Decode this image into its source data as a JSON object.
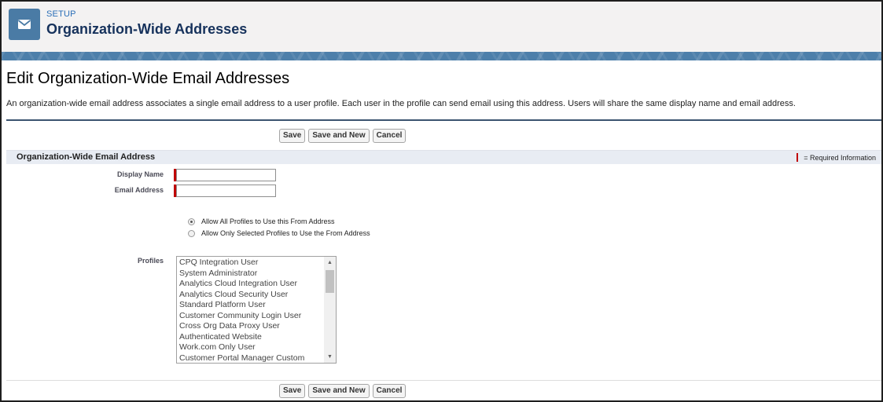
{
  "header": {
    "eyebrow": "SETUP",
    "title": "Organization-Wide Addresses",
    "icon": "envelope-icon",
    "icon_bg": "#4a7ba5"
  },
  "page": {
    "title": "Edit Organization-Wide Email Addresses",
    "description": "An organization-wide email address associates a single email address to a user profile. Each user in the profile can send email using this address. Users will share the same display name and email address."
  },
  "buttons": {
    "save": "Save",
    "save_new": "Save and New",
    "cancel": "Cancel"
  },
  "section": {
    "title": "Organization-Wide Email Address",
    "required_legend": "= Required Information",
    "required_color": "#c00000"
  },
  "form": {
    "display_name_label": "Display Name",
    "display_name_value": "",
    "email_label": "Email Address",
    "email_value": "",
    "radio_all": "Allow All Profiles to Use this From Address",
    "radio_selected": "Allow Only Selected Profiles to Use the From Address",
    "radio_checked": "all",
    "profiles_label": "Profiles",
    "profiles": [
      "CPQ Integration User",
      "System Administrator",
      "Analytics Cloud Integration User",
      "Analytics Cloud Security User",
      "Standard Platform User",
      "Customer Community Login User",
      "Cross Org Data Proxy User",
      "Authenticated Website",
      "Work.com Only User",
      "Customer Portal Manager Custom"
    ]
  }
}
